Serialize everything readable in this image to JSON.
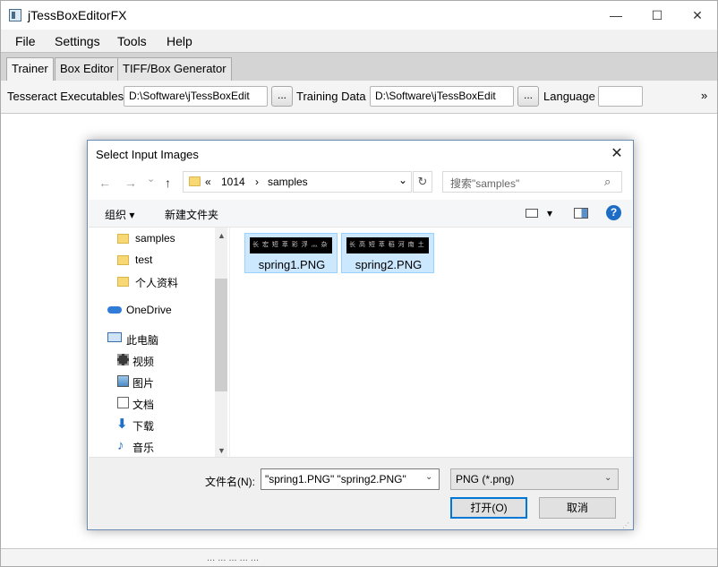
{
  "app": {
    "title": "jTessBoxEditorFX",
    "window_controls": {
      "minimize": "—",
      "maximize": "☐",
      "close": "✕"
    },
    "menu": [
      "File",
      "Settings",
      "Tools",
      "Help"
    ],
    "tabs": [
      "Trainer",
      "Box Editor",
      "TIFF/Box Generator"
    ],
    "toolbar": {
      "exe_label": "Tesseract Executables",
      "exe_value": "D:\\Software\\jTessBoxEdit",
      "browse1": "...",
      "training_label": "Training Data",
      "training_value": "D:\\Software\\jTessBoxEdit",
      "browse2": "...",
      "language_label": "Language",
      "language_value": "",
      "overflow": "»"
    },
    "status_text": "... ... ... ... ..."
  },
  "dialog": {
    "title": "Select Input Images",
    "close": "✕",
    "nav": {
      "back": "←",
      "forward": "→",
      "dropdown": "⌄",
      "up": "↑"
    },
    "address": {
      "prefix": "«",
      "crumb1": "1014",
      "sep": "›",
      "crumb2": "samples",
      "dropdown": "⌄"
    },
    "refresh": "↻",
    "search_placeholder": "搜索\"samples\"",
    "search_icon": "⌕",
    "commands": {
      "organize": "组织 ▾",
      "new_folder": "新建文件夹",
      "view_dd": "▾",
      "help": "?"
    },
    "nav_items": [
      "samples",
      "test",
      "个人资料",
      "OneDrive",
      "此电脑",
      "视频",
      "图片",
      "文档",
      "下载",
      "音乐"
    ],
    "scroll": {
      "up": "▲",
      "down": "▼"
    },
    "files": [
      {
        "name": "spring1.PNG",
        "thumb_text": "长 宏 短 萃  彩 浮 灬 杂"
      },
      {
        "name": "spring2.PNG",
        "thumb_text": "长 高 短 萃  稻 河 南 土"
      }
    ],
    "filename_label": "文件名(N):",
    "filename_value": "\"spring1.PNG\" \"spring2.PNG\"",
    "filename_dd": "⌄",
    "filetype": "PNG (*.png)",
    "filetype_dd": "⌄",
    "open_button": "打开(O)",
    "cancel_button": "取消",
    "grip": "⋰"
  }
}
